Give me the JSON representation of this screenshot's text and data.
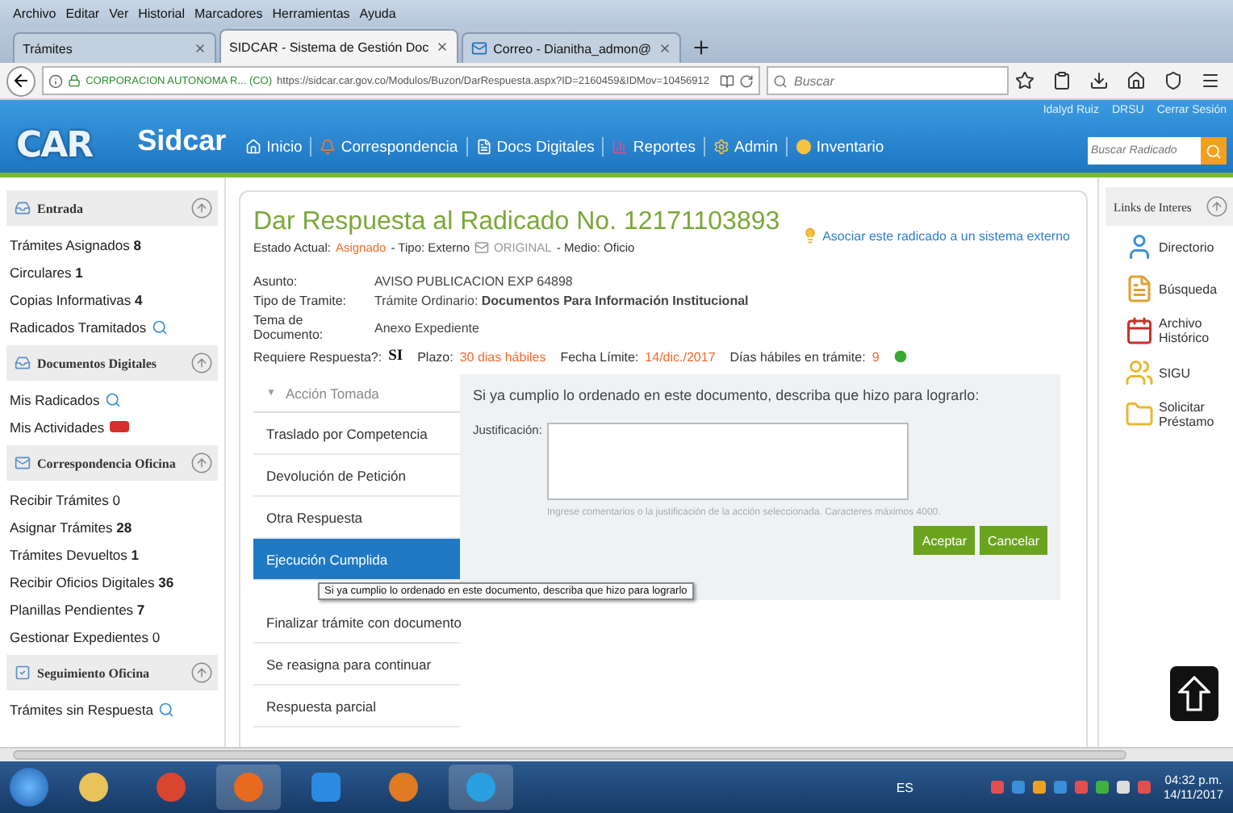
{
  "browser": {
    "menu": [
      "Archivo",
      "Editar",
      "Ver",
      "Historial",
      "Marcadores",
      "Herramientas",
      "Ayuda"
    ],
    "tabs": [
      {
        "title": "Trámites",
        "selected": false
      },
      {
        "title": "SIDCAR - Sistema de Gestión Doc",
        "selected": true
      },
      {
        "title": "Correo - Dianitha_admon@",
        "selected": false
      }
    ],
    "address": {
      "site": "CORPORACION AUTONOMA R... (CO)",
      "url": "https://sidcar.car.gov.co/Modulos/Buzon/DarRespuesta.aspx?ID=2160459&IDMov=10456912"
    },
    "search": {
      "placeholder": "Buscar"
    }
  },
  "app_header": {
    "logo": "CAR",
    "brand": "Sidcar",
    "nav": [
      "Inicio",
      "Correspondencia",
      "Docs Digitales",
      "Reportes",
      "Admin",
      "Inventario"
    ],
    "user": [
      "Idalyd Ruiz",
      "DRSU",
      "Cerrar Sesión"
    ],
    "search": {
      "placeholder": "Buscar Radicado"
    }
  },
  "sidebar": {
    "sections": [
      {
        "title": "Entrada",
        "items": [
          {
            "label": "Trámites Asignados **8**",
            "kind": "plain"
          },
          {
            "label": "Circulares **1**",
            "kind": "plain"
          },
          {
            "label": "Copias Informativas **4**",
            "kind": "plain"
          },
          {
            "label": "Radicados Tramitados",
            "kind": "search"
          }
        ]
      },
      {
        "title": "Documentos Digitales",
        "items": [
          {
            "label": "Mis Radicados",
            "kind": "search"
          },
          {
            "label": "Mis Actividades",
            "kind": "new"
          }
        ]
      },
      {
        "title": "Correspondencia Oficina",
        "items": [
          {
            "label": "Recibir Trámites 0",
            "kind": "plain"
          },
          {
            "label": "Asignar Trámites **28**",
            "kind": "plain"
          },
          {
            "label": "Trámites Devueltos **1**",
            "kind": "plain"
          },
          {
            "label": "Recibir Oficios Digitales **36**",
            "kind": "plain"
          },
          {
            "label": "Planillas Pendientes **7**",
            "kind": "plain"
          },
          {
            "label": "Gestionar Expedientes 0",
            "kind": "plain"
          }
        ]
      },
      {
        "title": "Seguimiento Oficina",
        "items": [
          {
            "label": "Trámites sin Respuesta",
            "kind": "search"
          }
        ]
      }
    ]
  },
  "main": {
    "title": "Dar Respuesta al Radicado No. 12171103893",
    "status": {
      "label": "Estado Actual:",
      "state": "Asignado",
      "type": "- Tipo: Externo",
      "copy": "ORIGINAL",
      "medium": "- Medio: Oficio"
    },
    "external_link": "Asociar este radicado a un sistema externo",
    "fields": [
      {
        "label": "Asunto:",
        "value": "AVISO PUBLICACION EXP 64898"
      },
      {
        "label": "Tipo de Tramite:",
        "value": "Trámite Ordinario: **Documentos Para Información Institucional**"
      },
      {
        "label": "Tema de Documento:",
        "value": "Anexo Expediente"
      }
    ],
    "requirements": [
      {
        "label": "Requiere Respuesta?:",
        "value": "SI"
      },
      {
        "label": "Plazo:",
        "value": "30 dias hábiles"
      },
      {
        "label": "Fecha Límite:",
        "value": "14/dic./2017"
      },
      {
        "label": "Días hábiles en trámite:",
        "value": "9"
      }
    ],
    "actions": {
      "marker": "▼",
      "header": "Acción Tomada",
      "items": [
        {
          "label": "Traslado por Competencia",
          "selected": false
        },
        {
          "label": "Devolución de Petición",
          "selected": false
        },
        {
          "label": "Otra Respuesta",
          "selected": false
        },
        {
          "label": "Ejecución Cumplida",
          "selected": true
        },
        {
          "label": "Finalizar trámite con documento",
          "selected": false
        },
        {
          "label": "Se reasigna para continuar",
          "selected": false
        },
        {
          "label": "Respuesta parcial",
          "selected": false
        }
      ]
    },
    "form": {
      "heading": "Si ya cumplio lo ordenado en este documento, describa que hizo para lograrlo:",
      "field_label": "Justificación:",
      "hint": "Ingrese comentarios o la justificación de la acción seleccionada. Caracteres máximos 4000.",
      "buttons": [
        "Aceptar",
        "Cancelar"
      ]
    },
    "tooltip": "Si ya cumplio lo ordenado en este documento, describa que hizo para lograrlo"
  },
  "links": {
    "title": "Links de Interes",
    "items": [
      "Directorio",
      "Búsqueda",
      "Archivo Histórico",
      "SIGU",
      "Solicitar Préstamo"
    ]
  },
  "taskbar": {
    "language": "ES",
    "time": "04:32 p.m.",
    "date": "14/11/2017"
  }
}
